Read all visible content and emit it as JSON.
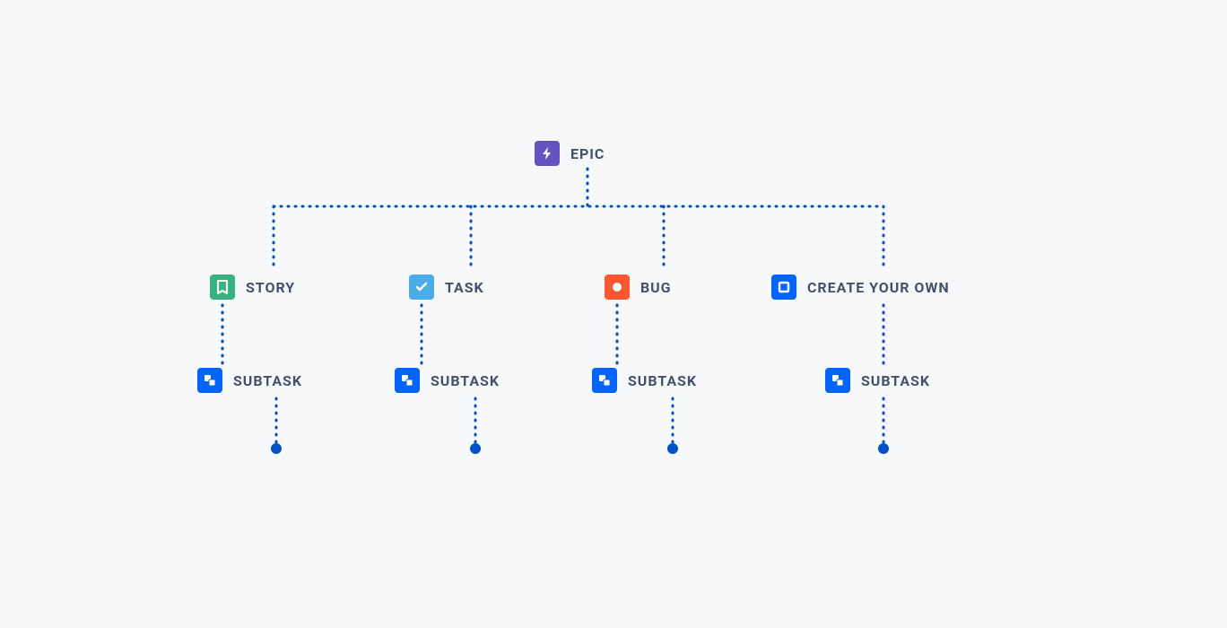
{
  "colors": {
    "connector": "#0052CC",
    "text": "#42526E",
    "bg": "#F7F8F9"
  },
  "nodes": {
    "epic": {
      "label": "EPIC"
    },
    "story": {
      "label": "STORY"
    },
    "task": {
      "label": "TASK"
    },
    "bug": {
      "label": "BUG"
    },
    "create": {
      "label": "CREATE YOUR OWN"
    },
    "sub1": {
      "label": "SUBTASK"
    },
    "sub2": {
      "label": "SUBTASK"
    },
    "sub3": {
      "label": "SUBTASK"
    },
    "sub4": {
      "label": "SUBTASK"
    }
  }
}
